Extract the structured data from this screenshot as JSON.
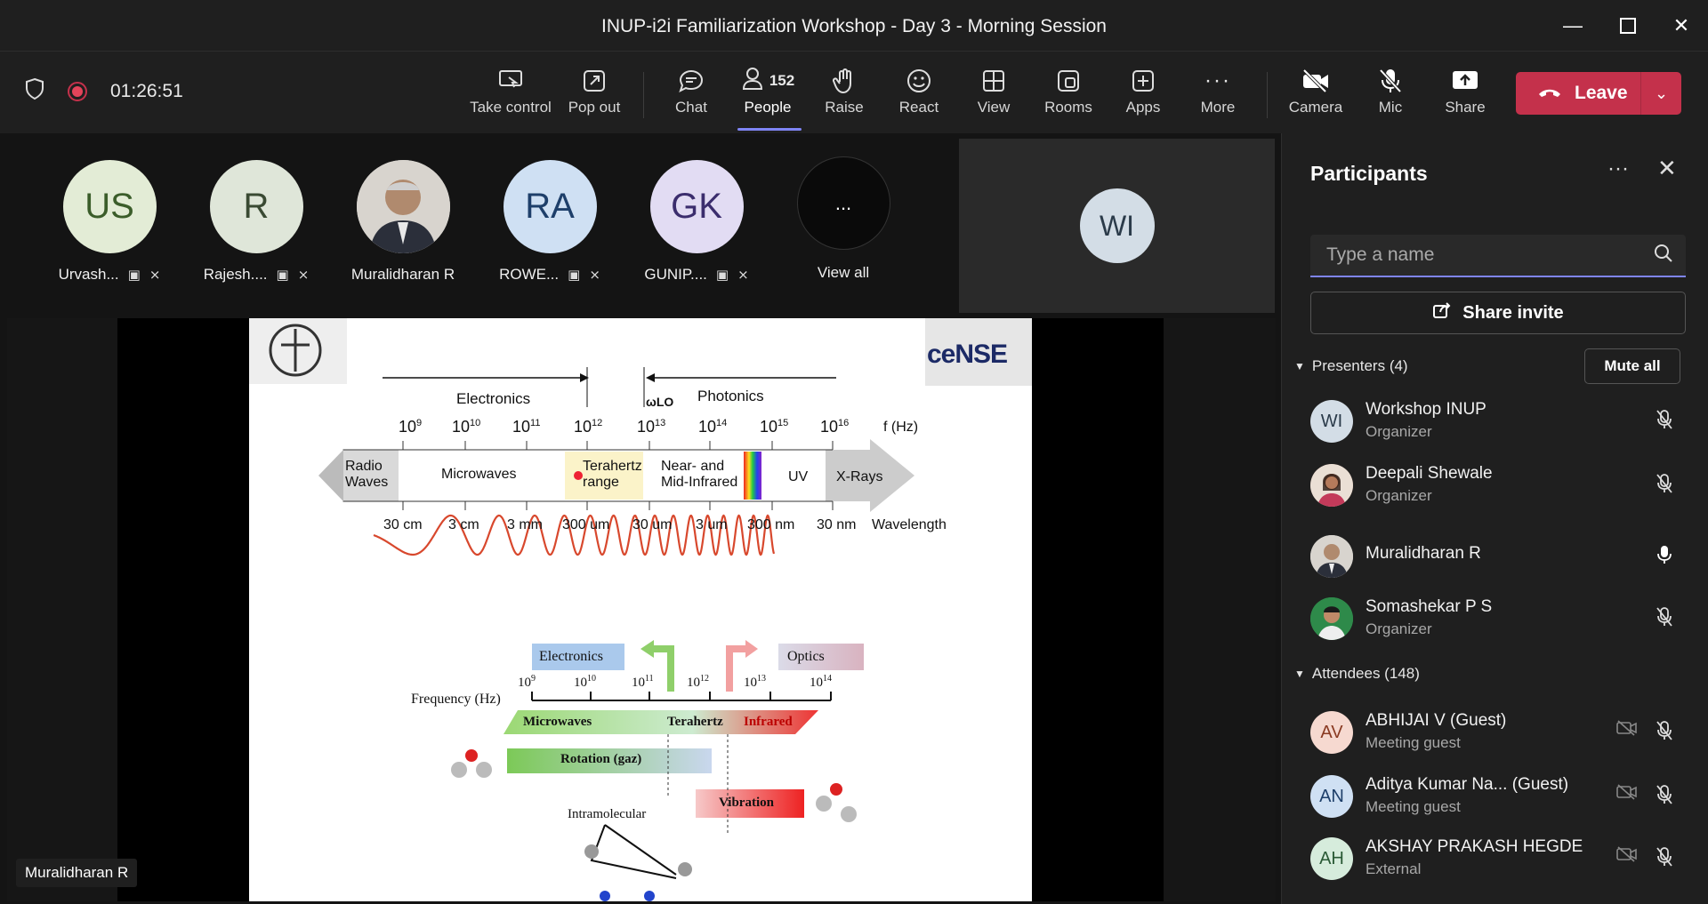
{
  "window": {
    "title": "INUP-i2i Familiarization Workshop - Day 3 - Morning Session"
  },
  "toolbar": {
    "timer": "01:26:51",
    "take_control": "Take control",
    "pop_out": "Pop out",
    "chat": "Chat",
    "people": "People",
    "people_count": "152",
    "raise": "Raise",
    "react": "React",
    "view": "View",
    "rooms": "Rooms",
    "apps": "Apps",
    "more": "More",
    "camera": "Camera",
    "mic": "Mic",
    "share": "Share",
    "leave": "Leave"
  },
  "thumbnails": [
    {
      "initials": "US",
      "name": "Urvash...",
      "bg": "#e3ecd6",
      "fg": "#3b5d2a"
    },
    {
      "initials": "R",
      "name": "Rajesh....",
      "bg": "#dfe6d9",
      "fg": "#3a4a33"
    },
    {
      "initials": "",
      "name": "Muralidharan R",
      "bg": "#cfcfcf",
      "fg": "#333"
    },
    {
      "initials": "RA",
      "name": "ROWE...",
      "bg": "#cfe0f3",
      "fg": "#1e3f6a"
    },
    {
      "initials": "GK",
      "name": "GUNIP....",
      "bg": "#e2dcf3",
      "fg": "#3b2d6d"
    },
    {
      "initials": "...",
      "name": "View all",
      "bg": "#0a0a0a",
      "fg": "#fff"
    }
  ],
  "stage_tile": {
    "initials": "WI",
    "bg": "#d3dde6",
    "fg": "#2b3b4a"
  },
  "share_presenter": "Muralidharan R",
  "slide": {
    "electronics": "Electronics",
    "photonics": "Photonics",
    "omega": "ωLO",
    "freq_unit": "f (Hz)",
    "exponents": [
      "9",
      "10",
      "11",
      "12",
      "13",
      "14",
      "15",
      "16"
    ],
    "bands": [
      "Radio Waves",
      "Microwaves",
      "Terahertz range",
      "Near- and Mid-Infrared",
      "UV",
      "X-Rays"
    ],
    "wavelengths": [
      "30 cm",
      "3 cm",
      "3 mm",
      "300 um",
      "30 um",
      "3 um",
      "300 nm",
      "30 nm",
      "Wavelength"
    ],
    "lower": {
      "electronics": "Electronics",
      "optics": "Optics",
      "freq": "Frequency (Hz)",
      "exps": [
        "9",
        "10",
        "11",
        "12",
        "13",
        "14"
      ],
      "microwaves": "Microwaves",
      "terahertz": "Terahertz",
      "infrared": "Infrared",
      "rotation": "Rotation (gaz)",
      "vibration": "Vibration",
      "intramolecular": "Intramolecular"
    },
    "logo_right": "ceNSE"
  },
  "panel": {
    "title": "Participants",
    "search_placeholder": "Type a name",
    "share_invite": "Share invite",
    "presenters_header": "Presenters (4)",
    "mute_all": "Mute all",
    "attendees_header": "Attendees (148)",
    "presenters": [
      {
        "initials": "WI",
        "name": "Workshop INUP",
        "role": "Organizer",
        "bg": "#d3dde6",
        "fg": "#2b3b4a"
      },
      {
        "initials": "",
        "name": "Deepali Shewale",
        "role": "Organizer",
        "bg": "#7a4a3a",
        "fg": "#fff"
      },
      {
        "initials": "",
        "name": "Muralidharan R",
        "role": "",
        "bg": "#cfcfcf",
        "fg": "#333"
      },
      {
        "initials": "",
        "name": "Somashekar P S",
        "role": "Organizer",
        "bg": "#2e8a4a",
        "fg": "#fff"
      }
    ],
    "attendees": [
      {
        "initials": "AV",
        "name": "ABHIJAI V (Guest)",
        "role": "Meeting guest",
        "bg": "#f6d9d0",
        "fg": "#8a3a22"
      },
      {
        "initials": "AN",
        "name": "Aditya Kumar Na... (Guest)",
        "role": "Meeting guest",
        "bg": "#cfe0f3",
        "fg": "#1e3f6a"
      },
      {
        "initials": "AH",
        "name": "AKSHAY PRAKASH HEGDE",
        "role": "External",
        "bg": "#d6ecdc",
        "fg": "#2a5a36"
      }
    ]
  }
}
